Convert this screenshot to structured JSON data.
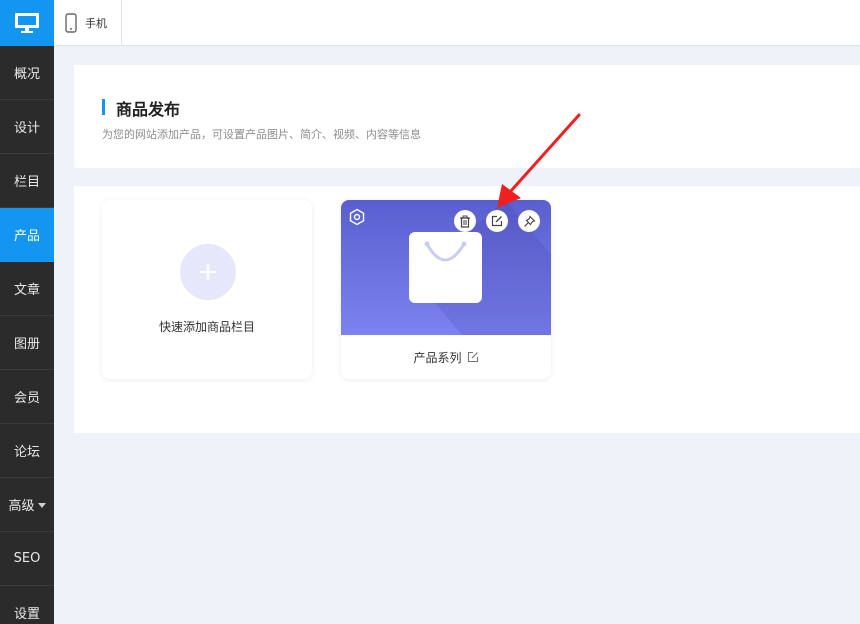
{
  "sidebar": {
    "items": [
      {
        "label": "概况"
      },
      {
        "label": "设计"
      },
      {
        "label": "栏目"
      },
      {
        "label": "产品",
        "active": true
      },
      {
        "label": "文章"
      },
      {
        "label": "图册"
      },
      {
        "label": "会员"
      },
      {
        "label": "论坛"
      },
      {
        "label": "高级",
        "has_dropdown": true
      },
      {
        "label": "SEO"
      },
      {
        "label": "设置"
      }
    ],
    "top_icon": "desktop-icon"
  },
  "topbar": {
    "mobile_tab": {
      "label": "手机",
      "icon": "mobile-phone-icon"
    }
  },
  "header": {
    "title": "商品发布",
    "subtitle": "为您的网站添加产品，可设置产品图片、简介、视频、内容等信息"
  },
  "cards": {
    "add": {
      "label": "快速添加商品栏目",
      "icon": "plus-icon"
    },
    "product": {
      "name": "产品系列",
      "icons": [
        "settings-icon",
        "trash-icon",
        "edit-icon",
        "pin-icon"
      ]
    }
  },
  "colors": {
    "accent": "#1296f0",
    "sidebar_bg": "#2b2b2b",
    "banner_top": "#5a5fcf",
    "banner_bottom": "#7b83f0",
    "annotation_arrow": "#f02020"
  }
}
